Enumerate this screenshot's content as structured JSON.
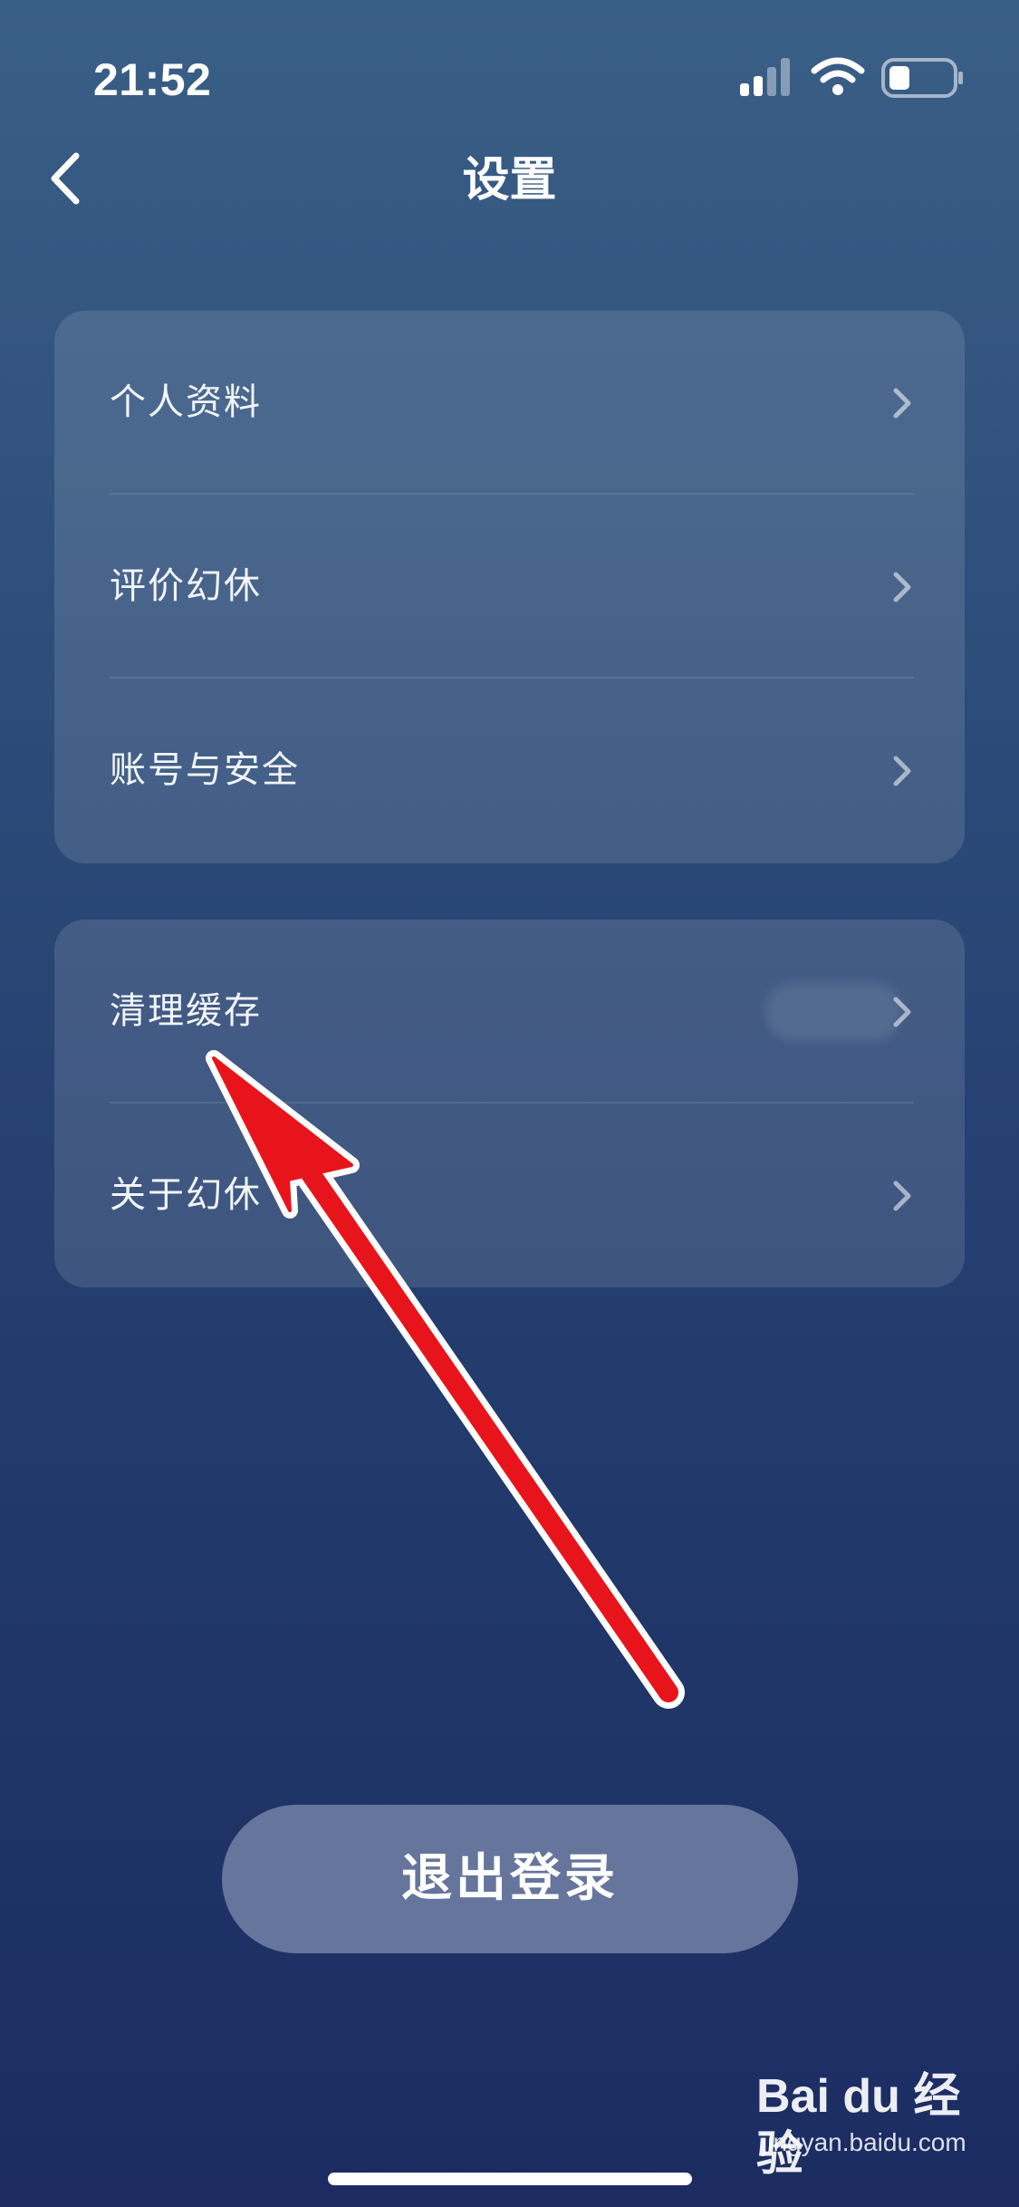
{
  "status_bar": {
    "time": "21:52",
    "icons": [
      "cellular-signal-icon",
      "wifi-icon",
      "battery-icon"
    ]
  },
  "header": {
    "back_icon": "chevron-left-icon",
    "title": "设置"
  },
  "settings_group_1": {
    "items": [
      {
        "label": "个人资料",
        "icon": "chevron-right-icon"
      },
      {
        "label": "评价幻休",
        "icon": "chevron-right-icon"
      },
      {
        "label": "账号与安全",
        "icon": "chevron-right-icon"
      }
    ]
  },
  "settings_group_2": {
    "items": [
      {
        "label": "清理缓存",
        "icon": "chevron-right-icon"
      },
      {
        "label": "关于幻休",
        "icon": "chevron-right-icon"
      }
    ]
  },
  "logout": {
    "label": "退出登录"
  },
  "annotation": {
    "color": "#e8141c",
    "icon": "red-arrow-annotation"
  },
  "watermark": {
    "brand": "Bai du 经验",
    "url": "jingyan.baidu.com"
  },
  "colors": {
    "background_top": "#3a5f86",
    "background_bottom": "#1c2c62",
    "logout_button": "#65759c"
  }
}
